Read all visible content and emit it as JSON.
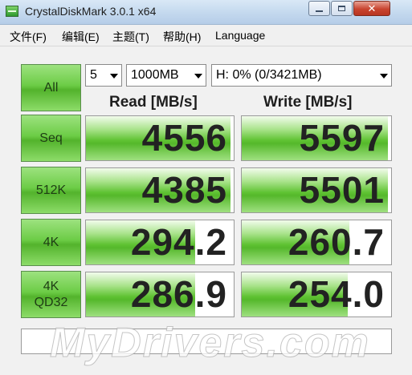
{
  "window": {
    "title": "CrystalDiskMark 3.0.1 x64",
    "close_glyph": "✕"
  },
  "menu": [
    {
      "label": "文件(F)"
    },
    {
      "label": "编辑(E)"
    },
    {
      "label": "主题(T)"
    },
    {
      "label": "帮助(H)"
    },
    {
      "label": "Language"
    }
  ],
  "controls": {
    "all_label": "All",
    "runs": "5",
    "size": "1000MB",
    "drive": "H: 0% (0/3421MB)"
  },
  "columns": {
    "read": "Read [MB/s]",
    "write": "Write [MB/s]"
  },
  "tests": [
    {
      "label": "Seq",
      "read": "4556",
      "write": "5597",
      "read_fill": 0.98,
      "write_fill": 0.98
    },
    {
      "label": "512K",
      "read": "4385",
      "write": "5501",
      "read_fill": 0.98,
      "write_fill": 0.98
    },
    {
      "label": "4K",
      "read": "294.2",
      "write": "260.7",
      "read_fill": 0.74,
      "write_fill": 0.72
    },
    {
      "label": "4K\nQD32",
      "read": "286.9",
      "write": "254.0",
      "read_fill": 0.74,
      "write_fill": 0.71
    }
  ],
  "watermark": "MyDrivers.com",
  "colors": {
    "accent_green": "#55b82b",
    "titlebar": "#c3d8ee"
  }
}
